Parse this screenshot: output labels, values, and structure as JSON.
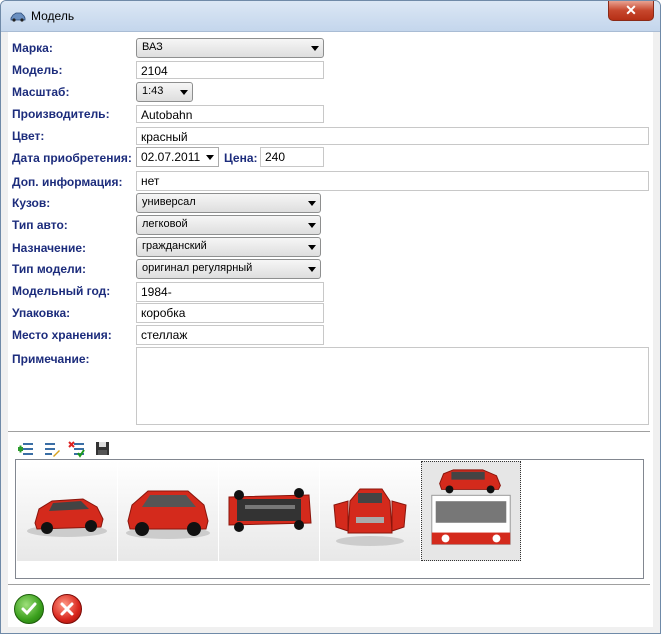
{
  "window": {
    "title": "Модель",
    "close_glyph": "✕"
  },
  "form": {
    "brand_label": "Марка:",
    "brand_value": "ВАЗ",
    "model_label": "Модель:",
    "model_value": "2104",
    "scale_label": "Масштаб:",
    "scale_value": "1:43",
    "manufacturer_label": "Производитель:",
    "manufacturer_value": "Autobahn",
    "color_label": "Цвет:",
    "color_value": "красный",
    "purchase_date_label": "Дата приобретения:",
    "purchase_date_value": "02.07.2011",
    "price_label": "Цена:",
    "price_value": "240",
    "extra_info_label": "Доп. информация:",
    "extra_info_value": "нет",
    "body_label": "Кузов:",
    "body_value": "универсал",
    "car_type_label": "Тип авто:",
    "car_type_value": "легковой",
    "purpose_label": "Назначение:",
    "purpose_value": "гражданский",
    "model_type_label": "Тип модели:",
    "model_type_value": "оригинал регулярный",
    "model_year_label": "Модельный год:",
    "model_year_value": "1984-",
    "packaging_label": "Упаковка:",
    "packaging_value": "коробка",
    "storage_label": "Место хранения:",
    "storage_value": "стеллаж",
    "notes_label": "Примечание:",
    "notes_value": ""
  },
  "toolbar": {
    "icons": [
      "add-photo-icon",
      "edit-photo-icon",
      "delete-photo-icon",
      "save-icon"
    ]
  },
  "gallery": {
    "thumbnails": [
      "car-front-three-quarter",
      "car-rear-three-quarter",
      "car-underside",
      "car-doors-open",
      "car-in-box"
    ],
    "selected_index": 4
  },
  "footer": {
    "ok_icon": "check-icon",
    "cancel_icon": "cross-icon"
  },
  "colors": {
    "label": "#1c2c7c",
    "car_red": "#d42a1c",
    "ok_green": "#3a9f1c",
    "cancel_red": "#d8251c"
  }
}
